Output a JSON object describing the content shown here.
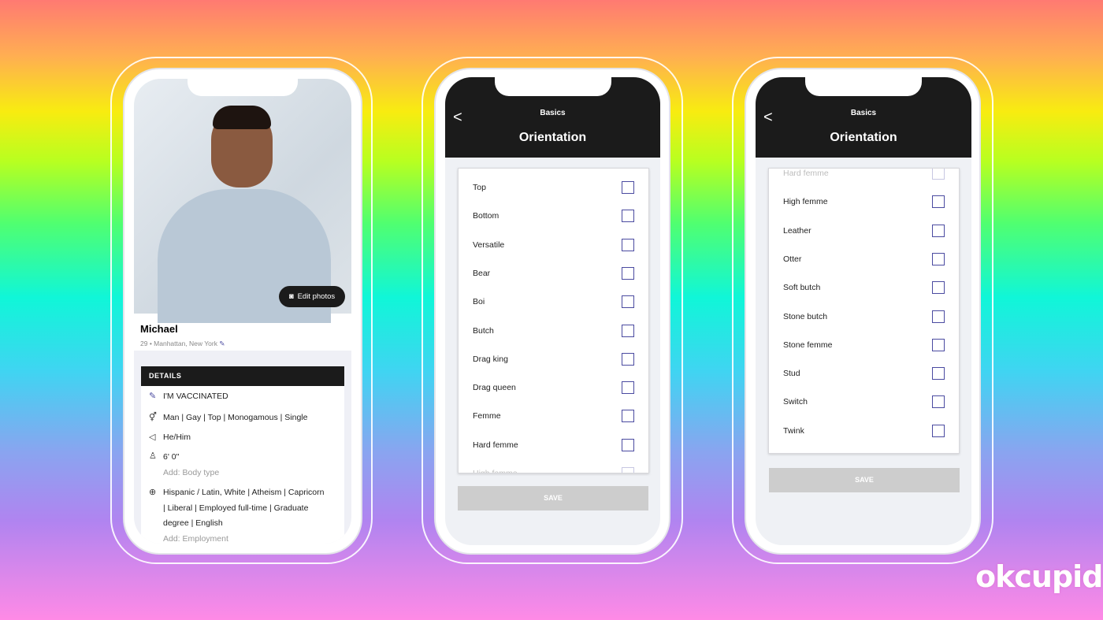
{
  "profile": {
    "edit_photos": "Edit photos",
    "name": "Michael",
    "location": "29 • Manhattan, New York",
    "details_header": "DETAILS",
    "vaccinated": "I'M VACCINATED",
    "identity": "Man | Gay | Top | Monogamous | Single",
    "pronouns": "He/Him",
    "height": "6' 0\"",
    "add_body": "Add: Body type",
    "background_line1": "Hispanic / Latin, White | Atheism | Capricorn",
    "background_line2": "| Liberal | Employed full-time | Graduate",
    "background_line3": "degree | English",
    "add_employment": "Add: Employment"
  },
  "screen2": {
    "back": "<",
    "subtitle": "Basics",
    "title": "Orientation",
    "items": [
      "Top",
      "Bottom",
      "Versatile",
      "Bear",
      "Boi",
      "Butch",
      "Drag king",
      "Drag queen",
      "Femme",
      "Hard femme",
      "High femme"
    ],
    "save": "SAVE"
  },
  "screen3": {
    "back": "<",
    "subtitle": "Basics",
    "title": "Orientation",
    "items": [
      "Hard femme",
      "High femme",
      "Leather",
      "Otter",
      "Soft butch",
      "Stone butch",
      "Stone femme",
      "Stud",
      "Switch",
      "Twink"
    ],
    "save": "SAVE"
  },
  "brand": {
    "logo": "okcupid",
    "accent": "#4a4aa0"
  }
}
